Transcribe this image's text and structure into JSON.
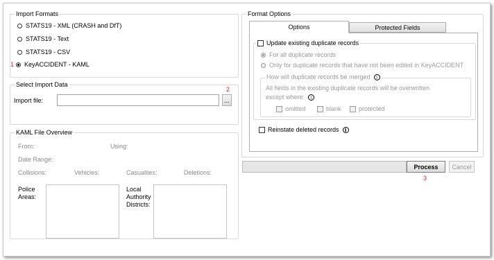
{
  "import_formats": {
    "title": "Import Formats",
    "options": [
      {
        "label": "STATS19 - XML (CRASH and DfT)",
        "selected": false
      },
      {
        "label": "STATS19 - Text",
        "selected": false
      },
      {
        "label": "STATS19 - CSV",
        "selected": false
      },
      {
        "label": "KeyACCIDENT - KAML",
        "selected": true
      }
    ],
    "marker": "1"
  },
  "select_import": {
    "title": "Select Import Data",
    "file_label": "Import file:",
    "file_value": "",
    "browse_label": "...",
    "marker": "2"
  },
  "kaml_overview": {
    "title": "KAML File Overview",
    "from_label": "From:",
    "using_label": "Using:",
    "date_range_label": "Date Range:",
    "collisions_label": "Collisions:",
    "vehicles_label": "Vehicles:",
    "casualties_label": "Casualties:",
    "deletions_label": "Deletions:",
    "police_areas_label": "Police\nAreas:",
    "local_authority_label": "Local\nAuthority\nDistricts:"
  },
  "format_options": {
    "title": "Format Options",
    "tabs": [
      {
        "label": "Options",
        "active": true
      },
      {
        "label": "Protected Fields",
        "active": false
      }
    ],
    "update_duplicates_label": "Update existing duplicate records",
    "update_duplicates_checked": false,
    "all_duplicates_label": "For all duplicate records",
    "only_unedited_label": "Only for duplicate records that have not been edited in KeyACCIDENT",
    "merge_title": "How will duplicate records be merged",
    "merge_text_1": "All fields in the existing duplicate records will be overwritten",
    "merge_text_2": "except where:",
    "omitted_label": "omitted",
    "blank_label": "blank",
    "protected_label": "protected",
    "reinstate_label": "Reinstate deleted records",
    "reinstate_checked": false
  },
  "footer": {
    "progress_value": 0,
    "process_label": "Process",
    "cancel_label": "Cancel",
    "marker": "3"
  },
  "icons": {
    "info": "info-icon"
  }
}
